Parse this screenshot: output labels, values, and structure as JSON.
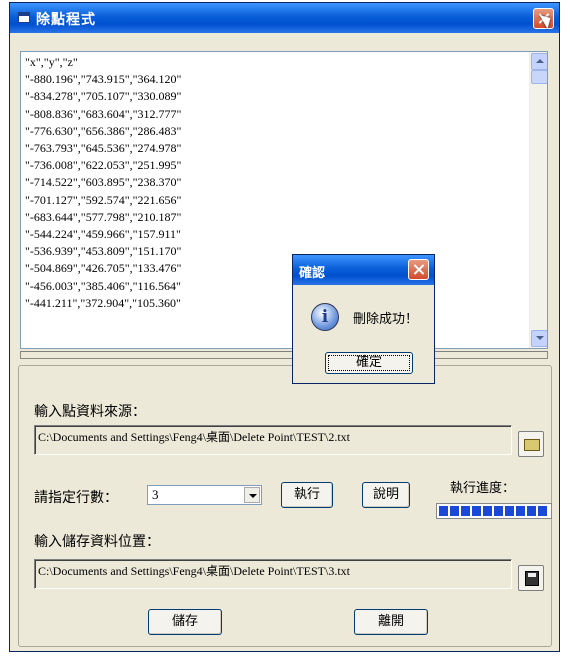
{
  "window": {
    "title": "除點程式"
  },
  "output": {
    "lines": [
      "\"x\",\"y\",\"z\"",
      "\"-880.196\",\"743.915\",\"364.120\"",
      "\"-834.278\",\"705.107\",\"330.089\"",
      "\"-808.836\",\"683.604\",\"312.777\"",
      "\"-776.630\",\"656.386\",\"286.483\"",
      "\"-763.793\",\"645.536\",\"274.978\"",
      "\"-736.008\",\"622.053\",\"251.995\"",
      "\"-714.522\",\"603.895\",\"238.370\"",
      "\"-701.127\",\"592.574\",\"221.656\"",
      "\"-683.644\",\"577.798\",\"210.187\"",
      "\"-544.224\",\"459.966\",\"157.911\"",
      "\"-536.939\",\"453.809\",\"151.170\"",
      "\"-504.869\",\"426.705\",\"133.476\"",
      "\"-456.003\",\"385.406\",\"116.564\"",
      "\"-441.211\",\"372.904\",\"105.360\""
    ]
  },
  "form": {
    "source_label": "輸入點資料來源：",
    "source_path": "C:\\Documents and Settings\\Feng4\\桌面\\Delete Point\\TEST\\2.txt",
    "rows_label": "請指定行數：",
    "rows_value": "3",
    "run_label": "執行",
    "help_label": "說明",
    "progress_label": "執行進度：",
    "progress_fraction": 1.0,
    "save_location_label": "輸入儲存資料位置：",
    "save_path": "C:\\Documents and Settings\\Feng4\\桌面\\Delete Point\\TEST\\3.txt",
    "save_label": "儲存",
    "exit_label": "離開"
  },
  "dialog": {
    "title": "確認",
    "message": "刪除成功！",
    "ok_label": "確定",
    "icon": "info-icon"
  }
}
